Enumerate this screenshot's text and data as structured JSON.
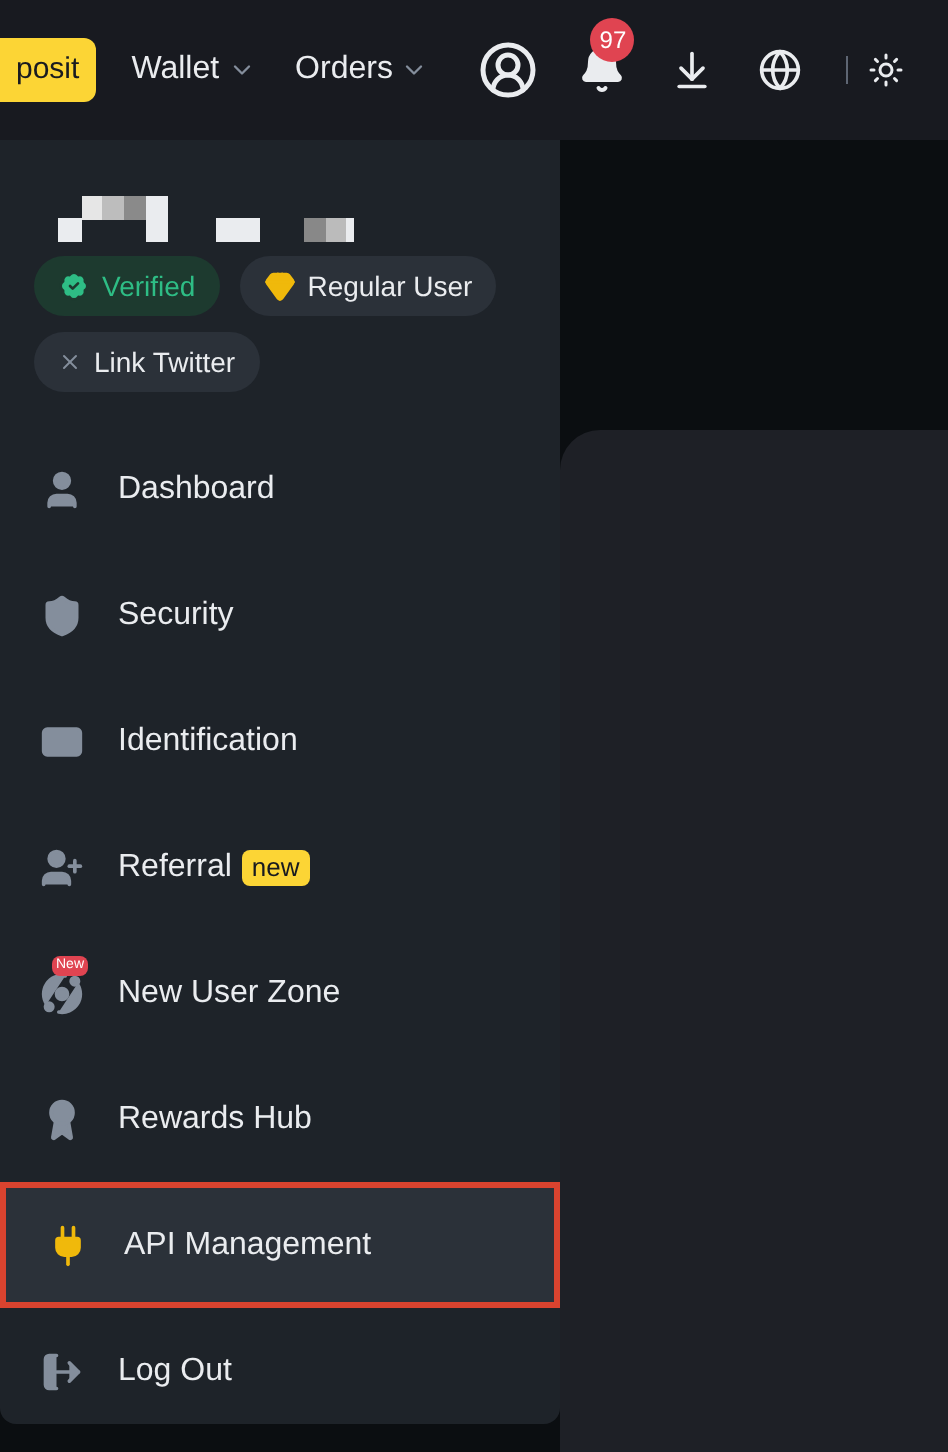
{
  "topbar": {
    "deposit_button": "posit",
    "menus": [
      {
        "label": "Wallet"
      },
      {
        "label": "Orders"
      }
    ],
    "notification_count": "97"
  },
  "profile": {
    "chips": [
      {
        "kind": "verified",
        "label": "Verified"
      },
      {
        "kind": "tier",
        "label": "Regular User"
      },
      {
        "kind": "link",
        "label": "Link Twitter"
      }
    ]
  },
  "menu": [
    {
      "label": "Dashboard",
      "selected": false
    },
    {
      "label": "Security",
      "selected": false
    },
    {
      "label": "Identification",
      "selected": false
    },
    {
      "label": "Referral",
      "tag": "new",
      "selected": false
    },
    {
      "label": "New User Zone",
      "icon_badge": "New",
      "selected": false
    },
    {
      "label": "Rewards Hub",
      "selected": false
    },
    {
      "label": "API Management",
      "selected": true
    },
    {
      "label": "Log Out",
      "selected": false
    }
  ]
}
